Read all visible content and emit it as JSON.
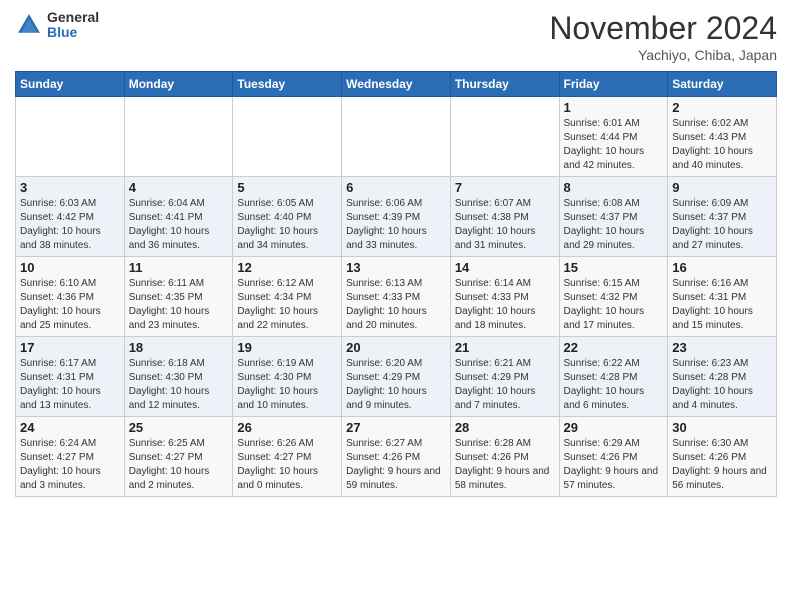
{
  "header": {
    "logo_general": "General",
    "logo_blue": "Blue",
    "month_title": "November 2024",
    "subtitle": "Yachiyo, Chiba, Japan"
  },
  "weekdays": [
    "Sunday",
    "Monday",
    "Tuesday",
    "Wednesday",
    "Thursday",
    "Friday",
    "Saturday"
  ],
  "weeks": [
    [
      {
        "day": "",
        "info": ""
      },
      {
        "day": "",
        "info": ""
      },
      {
        "day": "",
        "info": ""
      },
      {
        "day": "",
        "info": ""
      },
      {
        "day": "",
        "info": ""
      },
      {
        "day": "1",
        "info": "Sunrise: 6:01 AM\nSunset: 4:44 PM\nDaylight: 10 hours and 42 minutes."
      },
      {
        "day": "2",
        "info": "Sunrise: 6:02 AM\nSunset: 4:43 PM\nDaylight: 10 hours and 40 minutes."
      }
    ],
    [
      {
        "day": "3",
        "info": "Sunrise: 6:03 AM\nSunset: 4:42 PM\nDaylight: 10 hours and 38 minutes."
      },
      {
        "day": "4",
        "info": "Sunrise: 6:04 AM\nSunset: 4:41 PM\nDaylight: 10 hours and 36 minutes."
      },
      {
        "day": "5",
        "info": "Sunrise: 6:05 AM\nSunset: 4:40 PM\nDaylight: 10 hours and 34 minutes."
      },
      {
        "day": "6",
        "info": "Sunrise: 6:06 AM\nSunset: 4:39 PM\nDaylight: 10 hours and 33 minutes."
      },
      {
        "day": "7",
        "info": "Sunrise: 6:07 AM\nSunset: 4:38 PM\nDaylight: 10 hours and 31 minutes."
      },
      {
        "day": "8",
        "info": "Sunrise: 6:08 AM\nSunset: 4:37 PM\nDaylight: 10 hours and 29 minutes."
      },
      {
        "day": "9",
        "info": "Sunrise: 6:09 AM\nSunset: 4:37 PM\nDaylight: 10 hours and 27 minutes."
      }
    ],
    [
      {
        "day": "10",
        "info": "Sunrise: 6:10 AM\nSunset: 4:36 PM\nDaylight: 10 hours and 25 minutes."
      },
      {
        "day": "11",
        "info": "Sunrise: 6:11 AM\nSunset: 4:35 PM\nDaylight: 10 hours and 23 minutes."
      },
      {
        "day": "12",
        "info": "Sunrise: 6:12 AM\nSunset: 4:34 PM\nDaylight: 10 hours and 22 minutes."
      },
      {
        "day": "13",
        "info": "Sunrise: 6:13 AM\nSunset: 4:33 PM\nDaylight: 10 hours and 20 minutes."
      },
      {
        "day": "14",
        "info": "Sunrise: 6:14 AM\nSunset: 4:33 PM\nDaylight: 10 hours and 18 minutes."
      },
      {
        "day": "15",
        "info": "Sunrise: 6:15 AM\nSunset: 4:32 PM\nDaylight: 10 hours and 17 minutes."
      },
      {
        "day": "16",
        "info": "Sunrise: 6:16 AM\nSunset: 4:31 PM\nDaylight: 10 hours and 15 minutes."
      }
    ],
    [
      {
        "day": "17",
        "info": "Sunrise: 6:17 AM\nSunset: 4:31 PM\nDaylight: 10 hours and 13 minutes."
      },
      {
        "day": "18",
        "info": "Sunrise: 6:18 AM\nSunset: 4:30 PM\nDaylight: 10 hours and 12 minutes."
      },
      {
        "day": "19",
        "info": "Sunrise: 6:19 AM\nSunset: 4:30 PM\nDaylight: 10 hours and 10 minutes."
      },
      {
        "day": "20",
        "info": "Sunrise: 6:20 AM\nSunset: 4:29 PM\nDaylight: 10 hours and 9 minutes."
      },
      {
        "day": "21",
        "info": "Sunrise: 6:21 AM\nSunset: 4:29 PM\nDaylight: 10 hours and 7 minutes."
      },
      {
        "day": "22",
        "info": "Sunrise: 6:22 AM\nSunset: 4:28 PM\nDaylight: 10 hours and 6 minutes."
      },
      {
        "day": "23",
        "info": "Sunrise: 6:23 AM\nSunset: 4:28 PM\nDaylight: 10 hours and 4 minutes."
      }
    ],
    [
      {
        "day": "24",
        "info": "Sunrise: 6:24 AM\nSunset: 4:27 PM\nDaylight: 10 hours and 3 minutes."
      },
      {
        "day": "25",
        "info": "Sunrise: 6:25 AM\nSunset: 4:27 PM\nDaylight: 10 hours and 2 minutes."
      },
      {
        "day": "26",
        "info": "Sunrise: 6:26 AM\nSunset: 4:27 PM\nDaylight: 10 hours and 0 minutes."
      },
      {
        "day": "27",
        "info": "Sunrise: 6:27 AM\nSunset: 4:26 PM\nDaylight: 9 hours and 59 minutes."
      },
      {
        "day": "28",
        "info": "Sunrise: 6:28 AM\nSunset: 4:26 PM\nDaylight: 9 hours and 58 minutes."
      },
      {
        "day": "29",
        "info": "Sunrise: 6:29 AM\nSunset: 4:26 PM\nDaylight: 9 hours and 57 minutes."
      },
      {
        "day": "30",
        "info": "Sunrise: 6:30 AM\nSunset: 4:26 PM\nDaylight: 9 hours and 56 minutes."
      }
    ]
  ]
}
